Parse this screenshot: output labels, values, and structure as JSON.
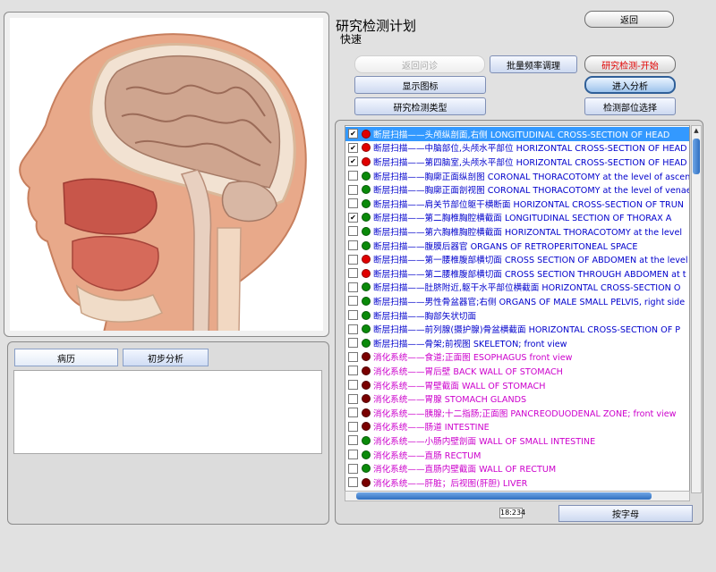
{
  "header": {
    "title": "研究检测计划",
    "subtitle": "快速"
  },
  "buttons": {
    "return": "返回",
    "review": "返回问诊",
    "batch": "批量频率调理",
    "start": "研究检测-开始",
    "show_icons": "显示图标",
    "enter_analysis": "进入分析",
    "study_type": "研究检测类型",
    "site_select": "检测部位选择",
    "by_letter": "按字母"
  },
  "tabs": {
    "history": "病历",
    "analysis": "初步分析"
  },
  "counter": "18:234",
  "colors": {
    "red": "#e00000",
    "green": "#0a8a0a",
    "darkred": "#7a0000",
    "blue": "#0000cc",
    "magenta": "#cc00cc",
    "selected": "#3399ff"
  },
  "list": [
    {
      "label": "断层扫描——头颅纵剖面,右侧 LONGITUDINAL CROSS-SECTION OF HEAD",
      "checked": true,
      "dot": "red",
      "text": "blue",
      "selected": true
    },
    {
      "label": "断层扫描——中脑部位,头颅水平部位 HORIZONTAL CROSS-SECTION OF HEAD",
      "checked": true,
      "dot": "red",
      "text": "blue"
    },
    {
      "label": "断层扫描——第四脑室,头颅水平部位 HORIZONTAL CROSS-SECTION OF HEAD",
      "checked": true,
      "dot": "red",
      "text": "blue"
    },
    {
      "label": "断层扫描——胸廓正面纵剖图 CORONAL THORACOTOMY at the level of ascen",
      "checked": false,
      "dot": "green",
      "text": "blue"
    },
    {
      "label": "断层扫描——胸廓正面剖视图 CORONAL THORACOTOMY at the level of venae",
      "checked": false,
      "dot": "green",
      "text": "blue"
    },
    {
      "label": "断层扫描——肩关节部位躯干横断面 HORIZONTAL CROSS-SECTION OF TRUN",
      "checked": false,
      "dot": "green",
      "text": "blue"
    },
    {
      "label": "断层扫描——第二胸椎胸腔横截面 LONGITUDINAL  SECTION  OF  THORAX  A",
      "checked": true,
      "dot": "green",
      "text": "blue"
    },
    {
      "label": "断层扫描——第六胸椎胸腔横截面 HORIZONTAL THORACOTOMY at the level",
      "checked": false,
      "dot": "green",
      "text": "blue"
    },
    {
      "label": "断层扫描——腹膜后器官 ORGANS OF RETROPERITONEAL SPACE",
      "checked": false,
      "dot": "green",
      "text": "blue"
    },
    {
      "label": "断层扫描——第一腰椎腹部横切面 CROSS SECTION OF ABDOMEN at the level",
      "checked": false,
      "dot": "red",
      "text": "blue"
    },
    {
      "label": "断层扫描——第二腰椎腹部横切面 CROSS SECTION THROUGH ABDOMEN at t",
      "checked": false,
      "dot": "red",
      "text": "blue"
    },
    {
      "label": "断层扫描——肚脐附近,躯干水平部位横截面 HORIZONTAL CROSS-SECTION O",
      "checked": false,
      "dot": "green",
      "text": "blue"
    },
    {
      "label": "断层扫描——男性骨盆器官;右侧 ORGANS OF MALE SMALL PELVIS, right side",
      "checked": false,
      "dot": "green",
      "text": "blue"
    },
    {
      "label": "断层扫描——胸部矢状切面",
      "checked": false,
      "dot": "green",
      "text": "blue"
    },
    {
      "label": "断层扫描——前列腺(摄护腺)骨盆横截面 HORIZONTAL CROSS-SECTION OF P",
      "checked": false,
      "dot": "green",
      "text": "blue"
    },
    {
      "label": "断层扫描——骨架;前视图 SKELETON;  front  view",
      "checked": false,
      "dot": "green",
      "text": "blue"
    },
    {
      "label": "消化系统——食道;正面图 ESOPHAGUS    front  view",
      "checked": false,
      "dot": "darkred",
      "text": "magenta"
    },
    {
      "label": "消化系统——胃后壁 BACK WALL OF STOMACH",
      "checked": false,
      "dot": "darkred",
      "text": "magenta"
    },
    {
      "label": "消化系统——胃壁截面 WALL OF STOMACH",
      "checked": false,
      "dot": "darkred",
      "text": "magenta"
    },
    {
      "label": "消化系统——胃腺 STOMACH  GLANDS",
      "checked": false,
      "dot": "darkred",
      "text": "magenta"
    },
    {
      "label": "消化系统——胰腺;十二指肠;正面图 PANCREODUODENAL  ZONE;  front  view",
      "checked": false,
      "dot": "darkred",
      "text": "magenta"
    },
    {
      "label": "消化系统——肠道 INTESTINE",
      "checked": false,
      "dot": "darkred",
      "text": "magenta"
    },
    {
      "label": "消化系统——小肠内壁剖面 WALL  OF  SMALL  INTESTINE",
      "checked": false,
      "dot": "green",
      "text": "magenta"
    },
    {
      "label": "消化系统——直肠 RECTUM",
      "checked": false,
      "dot": "green",
      "text": "magenta"
    },
    {
      "label": "消化系统——直肠内壁截面 WALL  OF  RECTUM",
      "checked": false,
      "dot": "green",
      "text": "magenta"
    },
    {
      "label": "消化系统——肝脏；后视图(肝胆) LIVER",
      "checked": false,
      "dot": "darkred",
      "text": "magenta"
    }
  ]
}
